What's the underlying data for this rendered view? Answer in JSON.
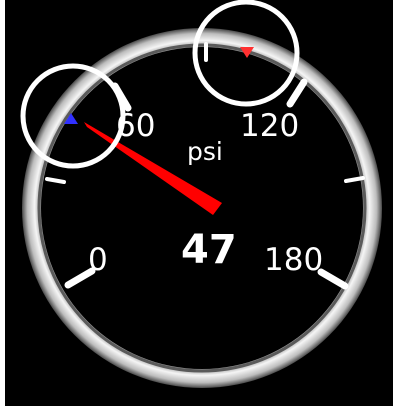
{
  "gauge": {
    "unit": "psi",
    "value": "47",
    "needle_value": 47,
    "scale_min": 0,
    "scale_max": 180,
    "tick_labels": [
      "0",
      "60",
      "120",
      "180"
    ],
    "min_marker_value": 47,
    "max_marker_value": 108,
    "min_marker_color": "#3030ff",
    "max_marker_color": "#ff3030",
    "needle_color": "#ff0000",
    "ring_color": "#e8e8e8",
    "face_color": "#000000",
    "highlight_circles": 2
  }
}
